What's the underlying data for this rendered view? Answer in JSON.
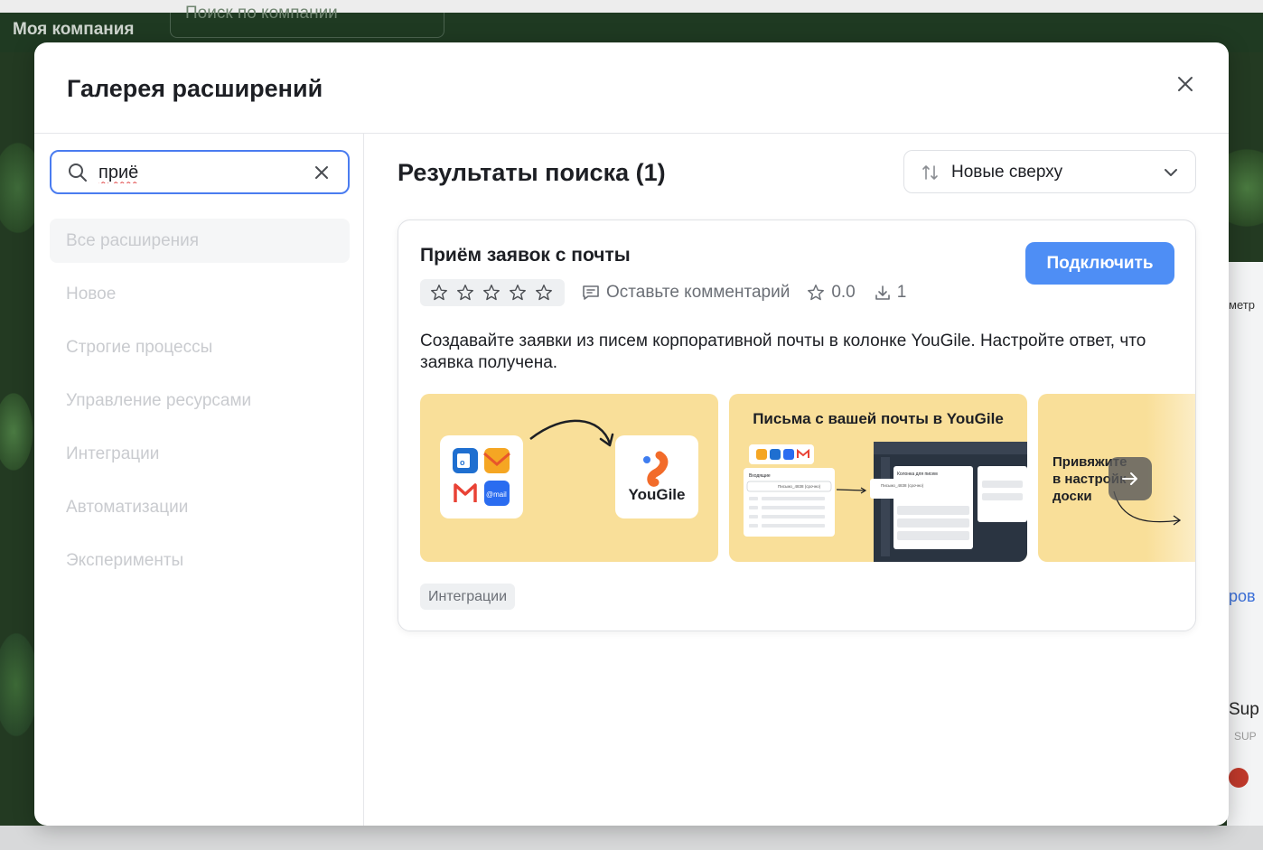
{
  "background": {
    "company_title": "Моя компания",
    "company_search_placeholder": "Поиск по компании",
    "right_text_1": "метр",
    "right_text_2": "ров",
    "right_text_3": "Sup",
    "right_text_4": "SUP"
  },
  "modal": {
    "title": "Галерея расширений",
    "close_icon": "close-icon"
  },
  "search": {
    "value": "приё",
    "icon": "search-icon",
    "clear_icon": "clear-icon"
  },
  "categories": [
    {
      "label": "Все расширения",
      "active": true
    },
    {
      "label": "Новое",
      "active": false
    },
    {
      "label": "Строгие процессы",
      "active": false
    },
    {
      "label": "Управление ресурсами",
      "active": false
    },
    {
      "label": "Интеграции",
      "active": false
    },
    {
      "label": "Автоматизации",
      "active": false
    },
    {
      "label": "Эксперименты",
      "active": false
    }
  ],
  "results": {
    "title": "Результаты поиска (1)",
    "sort_label": "Новые сверху",
    "sort_icon": "sort-arrows-icon"
  },
  "extension": {
    "title": "Приём заявок с почты",
    "connect_label": "Подключить",
    "comment_label": "Оставьте комментарий",
    "rating": "0.0",
    "downloads": "1",
    "description": "Создавайте заявки из писем корпоративной почты в колонке YouGile. Настройте ответ, что заявка получена.",
    "tag": "Интеграции",
    "shots": {
      "shot1_brand": "YouGile",
      "shot1_mail_label": "@mail",
      "shot2_title": "Письма с вашей почты в YouGile",
      "shot2_inbox": "Входящие",
      "shot2_column": "Колонка для писем",
      "shot2_item1": "Письмо_4838 (срочно)",
      "shot2_item2": "Письмо_4838 (срочно)",
      "shot3_text": "Привяжите в настройк доски"
    }
  },
  "colors": {
    "accent": "#4e8ef5",
    "shot_bg": "#f9df99",
    "yougile_orange": "#f26b2a",
    "yougile_blue": "#3e7df0"
  }
}
